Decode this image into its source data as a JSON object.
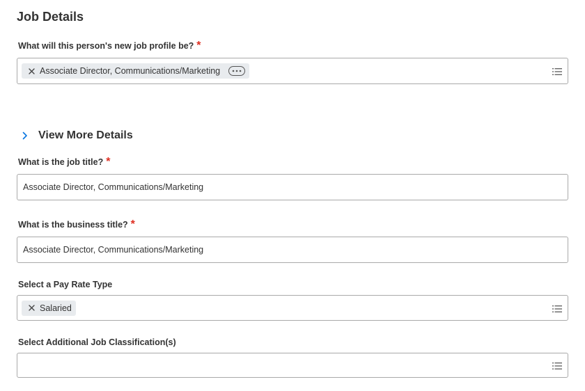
{
  "section": {
    "title": "Job Details"
  },
  "job_profile": {
    "label": "What will this person's new job profile be?",
    "required_mark": "*",
    "selected_value": "Associate Director, Communications/Marketing",
    "remove_icon": "close-icon",
    "related_actions_icon": "more-horizontal-icon",
    "prompt_icon": "list-icon"
  },
  "view_more": {
    "label": "View More Details",
    "icon": "chevron-right-icon"
  },
  "job_title": {
    "label": "What is the job title?",
    "required_mark": "*",
    "value": "Associate Director, Communications/Marketing"
  },
  "business_title": {
    "label": "What is the business title?",
    "required_mark": "*",
    "value": "Associate Director, Communications/Marketing"
  },
  "pay_rate_type": {
    "label": "Select a Pay Rate Type",
    "selected_value": "Salaried",
    "remove_icon": "close-icon",
    "prompt_icon": "list-icon"
  },
  "additional_classification": {
    "label": "Select Additional Job Classification(s)",
    "value": "",
    "prompt_icon": "list-icon"
  },
  "colors": {
    "required": "#de2e21",
    "chevron": "#0875e1",
    "border": "#a9a9a9",
    "pill_bg": "#e8ebee",
    "text": "#333333"
  }
}
